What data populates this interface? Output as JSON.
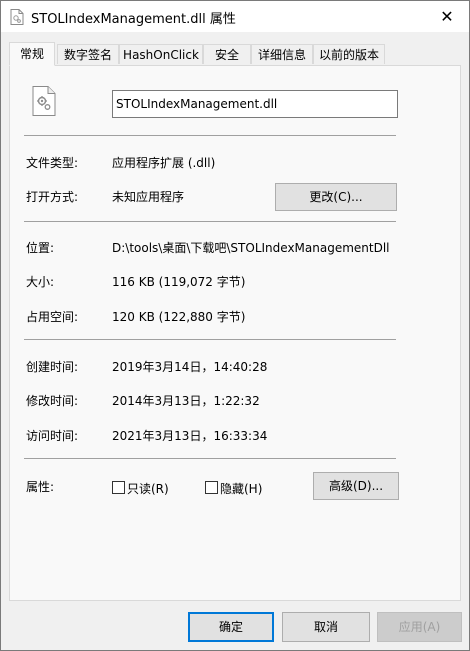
{
  "window": {
    "title": "STOLIndexManagement.dll 属性",
    "close_glyph": "✕"
  },
  "tabs": [
    {
      "label": "常规",
      "active": true
    },
    {
      "label": "数字签名",
      "active": false
    },
    {
      "label": "HashOnClick",
      "active": false
    },
    {
      "label": "安全",
      "active": false
    },
    {
      "label": "详细信息",
      "active": false
    },
    {
      "label": "以前的版本",
      "active": false
    }
  ],
  "general": {
    "file_name": "STOLIndexManagement.dll",
    "file_type_label": "文件类型:",
    "file_type_value": "应用程序扩展 (.dll)",
    "opens_with_label": "打开方式:",
    "opens_with_value": "未知应用程序",
    "change_button": "更改(C)...",
    "location_label": "位置:",
    "location_value": "D:\\tools\\桌面\\下载吧\\STOLIndexManagementDll",
    "size_label": "大小:",
    "size_value": "116 KB (119,072 字节)",
    "size_on_disk_label": "占用空间:",
    "size_on_disk_value": "120 KB (122,880 字节)",
    "created_label": "创建时间:",
    "created_value": "2019年3月14日，14:40:28",
    "modified_label": "修改时间:",
    "modified_value": "2014年3月13日，1:22:32",
    "accessed_label": "访问时间:",
    "accessed_value": "2021年3月13日，16:33:34",
    "attributes_label": "属性:",
    "readonly_label": "只读(R)",
    "readonly_checked": false,
    "hidden_label": "隐藏(H)",
    "hidden_checked": false,
    "advanced_button": "高级(D)..."
  },
  "footer": {
    "ok_button": "确定",
    "cancel_button": "取消",
    "apply_button": "应用(A)"
  },
  "colors": {
    "accent": "#0078d7",
    "panel_bg": "#f9f9f9",
    "window_bg": "#f0f0f0"
  }
}
